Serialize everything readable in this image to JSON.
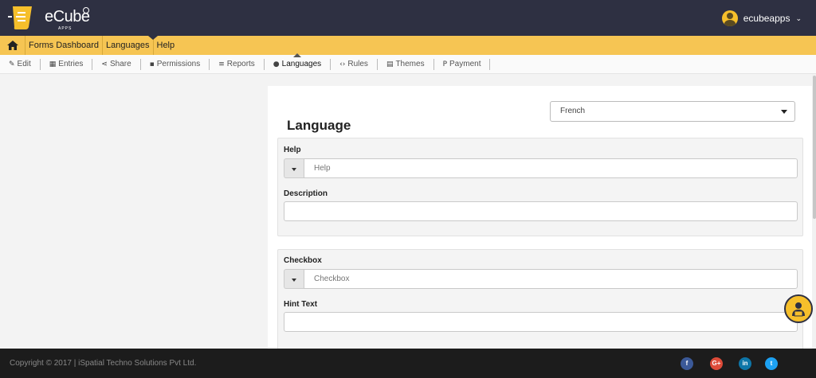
{
  "header": {
    "logo_text": "eCube",
    "logo_sub": "APPS",
    "username": "ecubeapps",
    "user_chevron": "⌄"
  },
  "breadcrumb": {
    "home_icon": "home-icon",
    "items": [
      "Forms Dashboard",
      "Languages",
      "Help"
    ]
  },
  "toolbar": {
    "items": [
      {
        "icon": "edit-icon",
        "glyph": "✎",
        "label": "Edit"
      },
      {
        "icon": "table-icon",
        "glyph": "▦",
        "label": "Entries"
      },
      {
        "icon": "share-icon",
        "glyph": "⋖",
        "label": "Share"
      },
      {
        "icon": "lock-icon",
        "glyph": "▪",
        "label": "Permissions"
      },
      {
        "icon": "database-icon",
        "glyph": "≡",
        "label": "Reports"
      },
      {
        "icon": "globe-icon",
        "glyph": "●",
        "label": "Languages",
        "active": true
      },
      {
        "icon": "code-icon",
        "glyph": "‹›",
        "label": "Rules"
      },
      {
        "icon": "themes-icon",
        "glyph": "▤",
        "label": "Themes"
      },
      {
        "icon": "paypal-icon",
        "glyph": "P",
        "label": "Payment"
      }
    ]
  },
  "main": {
    "title": "Language",
    "language_select": "French",
    "groups": [
      {
        "label": "Help",
        "translation_placeholder": "Help",
        "desc_label": "Description"
      },
      {
        "label": "Checkbox",
        "translation_placeholder": "Checkbox",
        "desc_label": "Hint Text"
      }
    ]
  },
  "footer": {
    "copyright": "Copyright © 2017 | iSpatial Techno Solutions Pvt Ltd.",
    "social": [
      {
        "icon": "facebook-icon",
        "glyph": "f",
        "color": "#3b5998"
      },
      {
        "icon": "google-plus-icon",
        "glyph": "G+",
        "color": "#dd4b39"
      },
      {
        "icon": "linkedin-icon",
        "glyph": "in",
        "color": "#0e76a8"
      },
      {
        "icon": "twitter-icon",
        "glyph": "t",
        "color": "#1da1f2"
      }
    ]
  },
  "colors": {
    "header_bg": "#2e3042",
    "breadcrumb_bg": "#f6c553",
    "accent": "#f6bf2b",
    "footer_bg": "#1c1c1c"
  }
}
